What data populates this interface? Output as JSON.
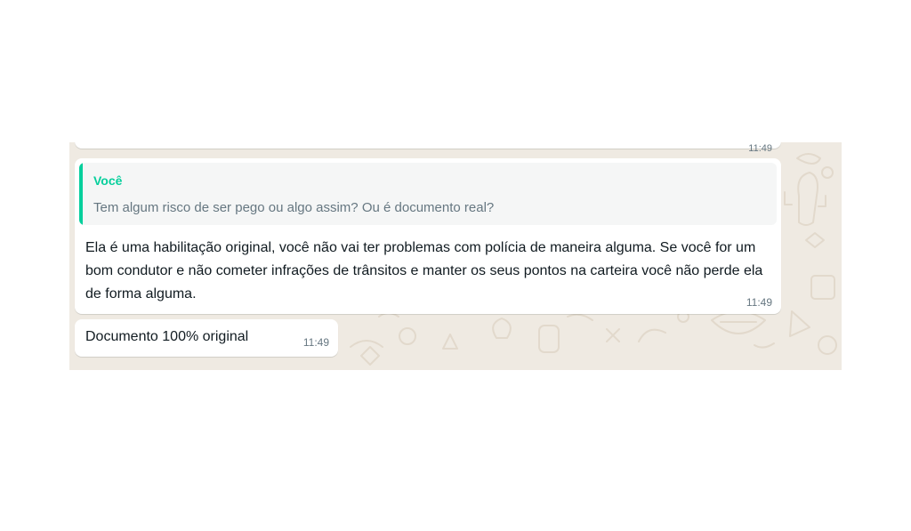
{
  "colors": {
    "wallpaper": "#efeae2",
    "bubble": "#ffffff",
    "quote_accent": "#06cf9c",
    "quote_background": "#f5f6f6",
    "text_primary": "#111b21",
    "text_secondary": "#667781"
  },
  "previous_message": {
    "time": "11:49"
  },
  "reply_message": {
    "quoted": {
      "author": "Você",
      "text": "Tem algum risco de ser pego ou algo assim? Ou é documento real?"
    },
    "text": "Ela é uma habilitação original, você não vai ter problemas com polícia de maneira alguma. Se você for um bom condutor e não cometer infrações de trânsitos e manter os seus pontos na carteira você não perde ela de forma alguma.",
    "time": "11:49"
  },
  "short_message": {
    "text": "Documento 100% original",
    "time": "11:49"
  }
}
